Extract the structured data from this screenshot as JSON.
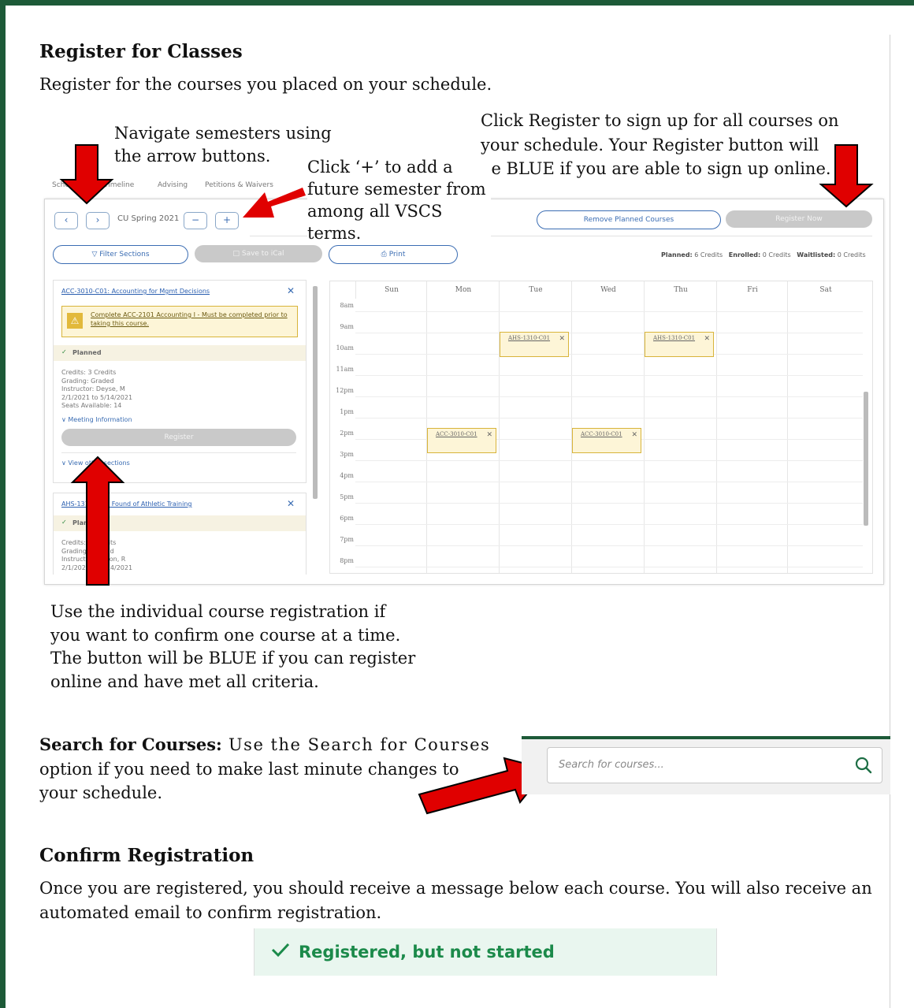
{
  "header": {
    "title": "Register for Classes",
    "subtitle": "Register for the courses you placed on your schedule."
  },
  "callouts": {
    "navigate_line1": "Navigate semesters using",
    "navigate_line2": "the arrow buttons.",
    "plus_line1": "Click ‘+’ to add a",
    "plus_line2": "future semester from",
    "plus_line3": "among all VSCS",
    "plus_line4": "terms.",
    "register_line1": "Click Register to sign up for all courses on",
    "register_line2": "your schedule. Your Register button will",
    "register_line3": "be BLUE if you are able to sign up online.",
    "individual_line1": "Use the individual course registration if",
    "individual_line2": "you want to confirm one course at a time.",
    "individual_line3": "The button will be BLUE if you can register",
    "individual_line4": "online and have met all criteria."
  },
  "app": {
    "tabs": [
      "Schedule",
      "Timeline",
      "Advising",
      "Petitions & Waivers"
    ],
    "term": "CU Spring 2021",
    "prev_glyph": "‹",
    "next_glyph": "›",
    "minus_glyph": "−",
    "plus_glyph": "+",
    "remove_planned": "Remove Planned Courses",
    "register_now": "Register Now",
    "filter_sections": "Filter Sections",
    "save_ical": "Save to iCal",
    "print": "Print",
    "planned_label": "Planned:",
    "planned_value": "6 Credits",
    "enrolled_label": "Enrolled:",
    "enrolled_value": "0 Credits",
    "waitlisted_label": "Waitlisted:",
    "waitlisted_value": "0 Credits",
    "course1": {
      "title": "ACC-3010-C01: Accounting for Mgmt Decisions",
      "warning": "Complete ACC-2101 Accounting I - Must be completed prior to taking this course.",
      "status": "Planned",
      "credits": "Credits: 3 Credits",
      "grading": "Grading: Graded",
      "instructor": "Instructor: Deyse, M",
      "dates": "2/1/2021 to 5/14/2021",
      "seats": "Seats Available: 14",
      "meeting": "Meeting Information",
      "register": "Register",
      "view_sections": "View other sections"
    },
    "course2": {
      "title": "AHS-1310-C01: Found of Athletic Training",
      "status": "Planned",
      "credits": "Credits: 3 Credits",
      "grading": "Grading: Graded",
      "instructor": "Instructor: Larson, R",
      "dates": "2/1/2021 to 5/14/2021"
    },
    "days": [
      "Sun",
      "Mon",
      "Tue",
      "Wed",
      "Thu",
      "Fri",
      "Sat"
    ],
    "hours": [
      "8am",
      "9am",
      "10am",
      "11am",
      "12pm",
      "1pm",
      "2pm",
      "3pm",
      "4pm",
      "5pm",
      "6pm",
      "7pm",
      "8pm"
    ],
    "events": [
      "AHS-1310-C01",
      "AHS-1310-C01",
      "ACC-3010-C01",
      "ACC-3010-C01"
    ]
  },
  "search_section": {
    "heading": "Search for Courses:",
    "text_line1": " Use the Search for Courses",
    "text_line2": "option if you need to make last minute changes to",
    "text_line3": "your schedule.",
    "placeholder": "Search for courses..."
  },
  "confirm_section": {
    "heading": "Confirm Registration",
    "text_line1": "Once you are registered, you should receive a message below each course. You will also receive an",
    "text_line2": "automated email to confirm registration.",
    "status": "Registered, but not started"
  },
  "colors": {
    "border_green": "#1d5a38",
    "arrow_red": "#e00000",
    "link_blue": "#3b6db3",
    "success_green": "#1b8a4a"
  }
}
